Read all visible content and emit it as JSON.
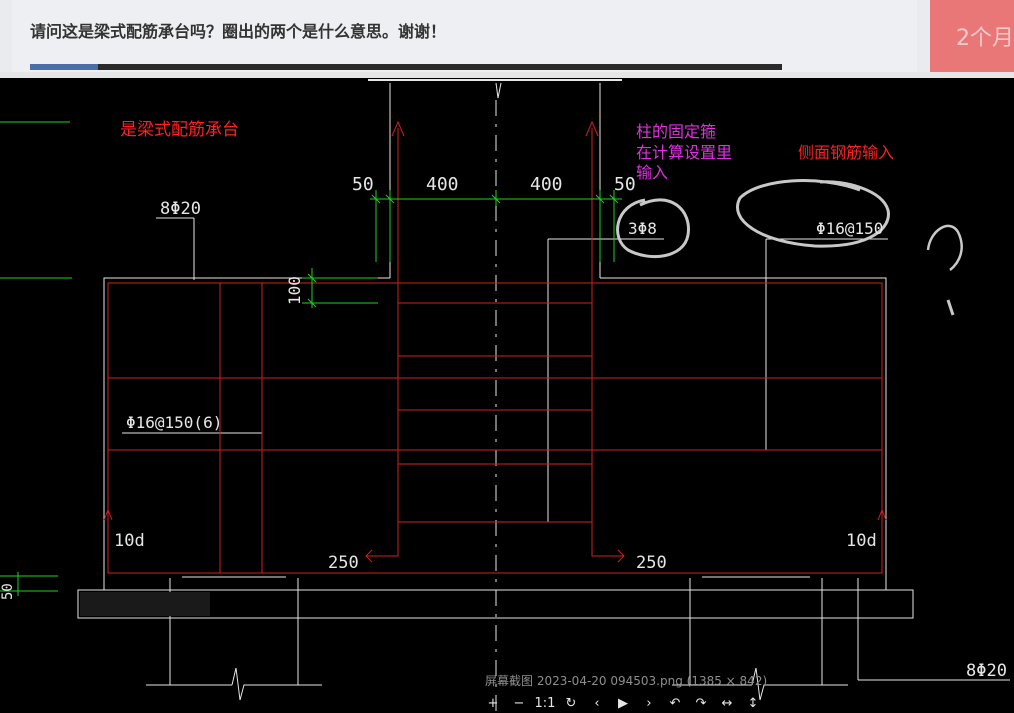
{
  "forum": {
    "question": "请问这是梁式配筋承台吗？圈出的两个是什么意思。谢谢！",
    "promo_text": "2个月"
  },
  "annotations": {
    "beam_cap": "是梁式配筋承台",
    "column_stirrup_line1": "柱的固定箍",
    "column_stirrup_line2": "在计算设置里",
    "column_stirrup_line3": "输入",
    "side_rebar": "侧面钢筋输入",
    "question_mark": "?"
  },
  "drawing": {
    "dims_top": [
      "50",
      "400",
      "400",
      "50"
    ],
    "dim_100": "100",
    "dim_50_left": "50",
    "rebar_top_left": "8Φ20",
    "rebar_stirrup_column": "3Φ8",
    "rebar_side": "Φ16@150",
    "rebar_stirrup_beam": "Φ16@150(6)",
    "anchor_left": "10d",
    "anchor_right": "10d",
    "bend_left": "250",
    "bend_right": "250",
    "rebar_bottom_right": "8Φ20"
  },
  "viewer": {
    "file_caption": "屏幕截图 2023-04-20 094503.png (1385 × 842)",
    "toolbar": [
      "+",
      "−",
      "1:1",
      "↻",
      "‹",
      "▶",
      "›",
      "↶",
      "↷",
      "↔",
      "↕"
    ]
  },
  "colors": {
    "background": "#000000",
    "rebar_red": "#d21f1f",
    "outline_white": "#e6e6e6",
    "dim_green": "#1fd21f",
    "annotation_red": "#ff2020",
    "annotation_magenta": "#e030e0",
    "circle_gray": "#c8c8c8"
  }
}
